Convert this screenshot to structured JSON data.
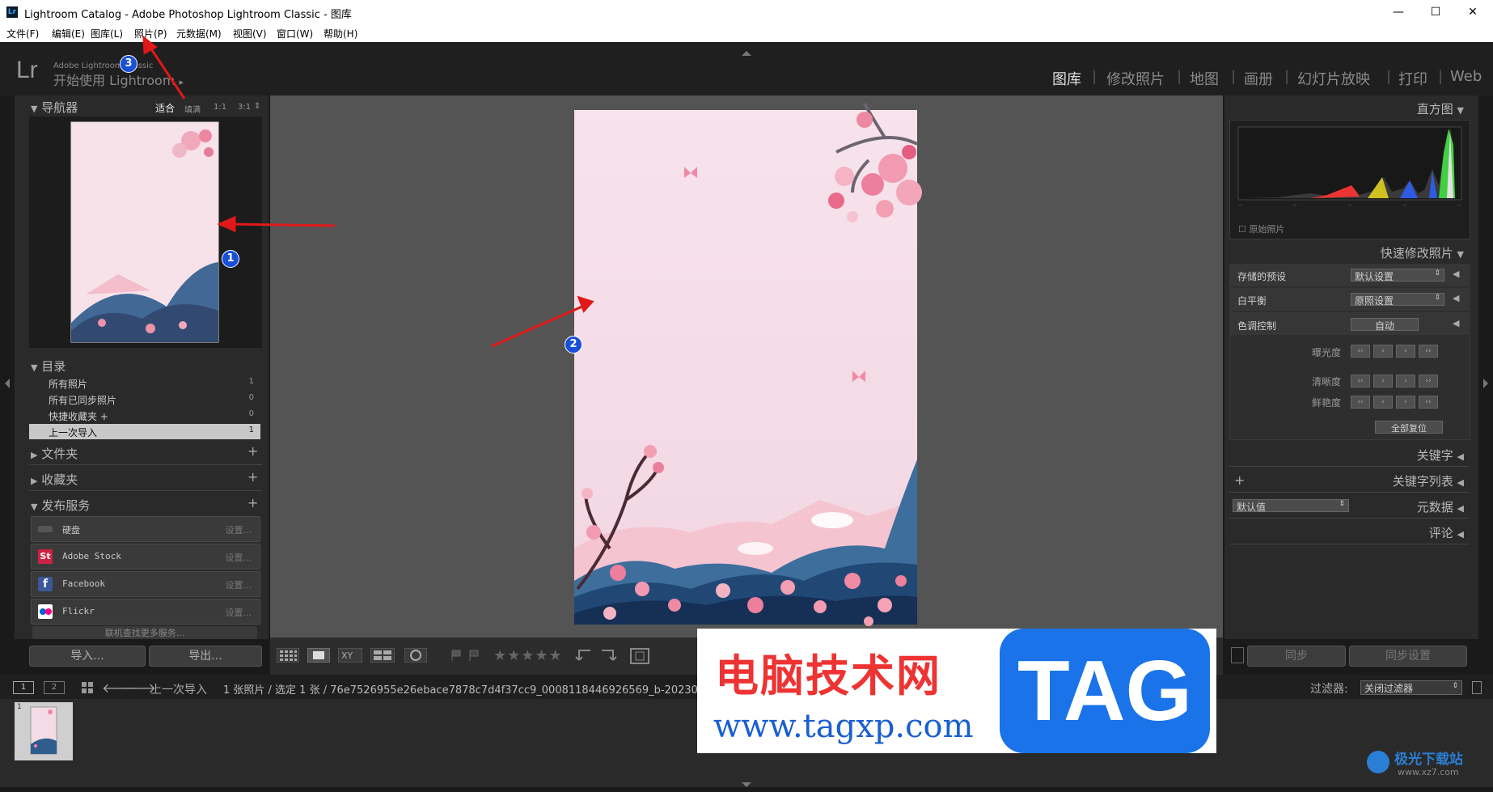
{
  "window": {
    "title": "Lightroom Catalog - Adobe Photoshop Lightroom Classic - 图库",
    "app_icon": "Lr",
    "minimize": "—",
    "maximize": "☐",
    "close": "✕"
  },
  "menu": [
    "文件(F)",
    "编辑(E)",
    "图库(L)",
    "照片(P)",
    "元数据(M)",
    "视图(V)",
    "窗口(W)",
    "帮助(H)"
  ],
  "identity": {
    "logo": "Lr",
    "small": "Adobe Lightroom Classic",
    "big": "开始使用 Lightroom",
    "arrow": "▸"
  },
  "modules": [
    "图库",
    "修改照片",
    "地图",
    "画册",
    "幻灯片放映",
    "打印",
    "Web"
  ],
  "module_sep": "|",
  "navigator": {
    "title": "导航器",
    "zoom": [
      "适合",
      "填满",
      "1:1",
      "3:1"
    ],
    "zoom_arrow": "⇕"
  },
  "catalog": {
    "title": "目录",
    "rows": [
      {
        "label": "所有照片",
        "count": "1"
      },
      {
        "label": "所有已同步照片",
        "count": "0"
      },
      {
        "label": "快捷收藏夹 +",
        "count": "0"
      },
      {
        "label": "上一次导入",
        "count": "1"
      }
    ]
  },
  "folders": {
    "title": "文件夹",
    "plus": "+"
  },
  "collections": {
    "title": "收藏夹",
    "plus": "+"
  },
  "publish": {
    "title": "发布服务",
    "plus": "+",
    "services": [
      {
        "label": "硬盘",
        "set": "设置..."
      },
      {
        "label": "Adobe Stock",
        "set": "设置...",
        "icon": "St"
      },
      {
        "label": "Facebook",
        "set": "设置...",
        "icon": "f"
      },
      {
        "label": "Flickr",
        "set": "设置..."
      }
    ],
    "find_more": "联机查找更多服务..."
  },
  "left_buttons": {
    "import": "导入...",
    "export": "导出..."
  },
  "right": {
    "histogram": {
      "title": "直方图",
      "original": "原始照片",
      "ticks": [
        "–",
        "–",
        "–",
        "–",
        "–"
      ]
    },
    "quick_develop": {
      "title": "快速修改照片",
      "preset_label": "存储的预设",
      "preset_value": "默认设置",
      "wb_label": "白平衡",
      "wb_value": "原照设置",
      "tone_label": "色调控制",
      "auto": "自动",
      "exposure": "曝光度",
      "clarity": "清晰度",
      "vibrance": "鲜艳度",
      "reset_all": "全部复位",
      "step_labels": [
        "‹‹",
        "‹",
        "›",
        "››"
      ]
    },
    "keywording": "关键字",
    "keyword_list": "关键字列表",
    "metadata": {
      "title": "元数据",
      "preset": "默认值"
    },
    "comments": "评论",
    "sync": "同步",
    "sync_settings": "同步设置"
  },
  "toolbar": {
    "stars": "★★★★★"
  },
  "filmbar": {
    "pages": [
      "1",
      "2"
    ],
    "source": "上一次导入",
    "info": "1 张照片 / 选定 1 张 / 76e7526955e26ebace7878c7d4f37cc9_0008118446926569_b-20230907170150-x6cpn94.jpg",
    "filter_label": "过滤器:",
    "filter_value": "关闭过滤器"
  },
  "filmstrip": {
    "index": "1"
  },
  "annotations": [
    "1",
    "2",
    "3"
  ],
  "watermark": {
    "site": "电脑技术网",
    "url": "www.tagxp.com",
    "tag": "TAG",
    "corner": "极光下载站",
    "corner_url": "www.xz7.com"
  }
}
